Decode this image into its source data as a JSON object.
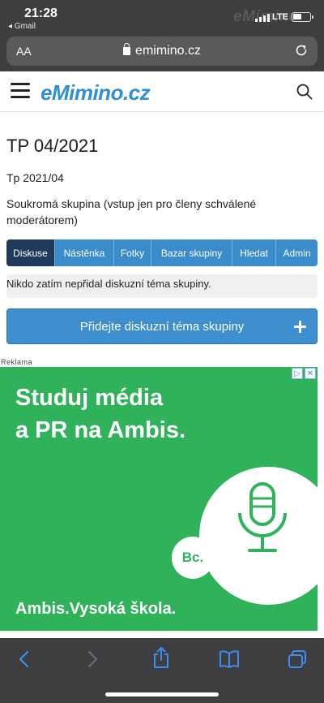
{
  "status": {
    "time": "21:28",
    "back_app": "◂ Gmail",
    "network": "LTE",
    "watermark": "eMimino"
  },
  "browser": {
    "text_size": "AA",
    "url": "emimino.cz"
  },
  "site": {
    "logo": "eMimino.cz"
  },
  "group": {
    "title": "TP 04/2021",
    "subtitle": "Tp 2021/04",
    "description": "Soukromá skupina (vstup jen pro členy schválené moderátorem)"
  },
  "tabs": [
    {
      "label": "Diskuse",
      "active": true
    },
    {
      "label": "Nástěnka",
      "active": false
    },
    {
      "label": "Fotky",
      "active": false
    },
    {
      "label": "Bazar skupiny",
      "active": false
    },
    {
      "label": "Hledat",
      "active": false
    },
    {
      "label": "Admin",
      "active": false
    }
  ],
  "notice": "Nikdo zatím nepřidal diskuzní téma skupiny.",
  "add_topic": {
    "label": "Přidejte diskuzní téma skupiny",
    "icon": "plus-icon"
  },
  "ad": {
    "label": "Reklama",
    "headline_line1": "Studuj média",
    "headline_line2": "a PR na Ambis.",
    "badge": "Bc.",
    "footer": "Ambis.Vysoká škola.",
    "choices_icons": [
      "adchoices-icon",
      "close-icon"
    ],
    "background_color": "#2fb25a"
  },
  "toolbar": {
    "icons": [
      "back-icon",
      "forward-icon",
      "share-icon",
      "bookmarks-icon",
      "tabs-icon"
    ]
  },
  "colors": {
    "accent": "#3a8ccb",
    "active_tab": "#1f3a5a",
    "browser_chrome": "#3e3e40"
  }
}
